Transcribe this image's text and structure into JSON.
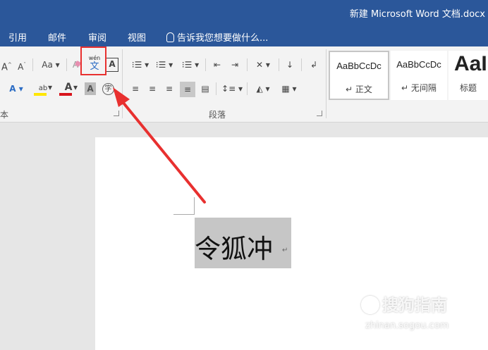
{
  "window": {
    "title": "新建 Microsoft Word 文档.docx"
  },
  "tabs": [
    {
      "label": "引用"
    },
    {
      "label": "邮件"
    },
    {
      "label": "审阅"
    },
    {
      "label": "视图"
    }
  ],
  "tell_me": {
    "placeholder": "告诉我您想要做什么..."
  },
  "ribbon": {
    "font": {
      "grow_label": "A",
      "shrink_label": "A",
      "case_label": "Aa",
      "clear_label": "A",
      "phonetic_top": "wén",
      "phonetic_bottom": "文",
      "border_char_label": "A",
      "text_effect_label": "A",
      "highlight_label": "ab",
      "font_color_label": "A",
      "shading_label": "A",
      "enclose_label": "字",
      "group_label": "本"
    },
    "paragraph": {
      "group_label": "段落"
    },
    "styles": {
      "items": [
        {
          "sample": "AaBbCcDc",
          "name": "正文"
        },
        {
          "sample": "AaBbCcDc",
          "name": "无间隔"
        },
        {
          "sample": "AaI",
          "name": "标题"
        }
      ]
    }
  },
  "document": {
    "text": "令狐冲",
    "paragraph_mark": "↵"
  },
  "watermark": {
    "text": "搜狗指南",
    "url": "zhinan.sogou.com"
  },
  "colors": {
    "title_bar": "#2b579a",
    "highlight_box": "#e8302f",
    "arrow": "#e8302f"
  }
}
